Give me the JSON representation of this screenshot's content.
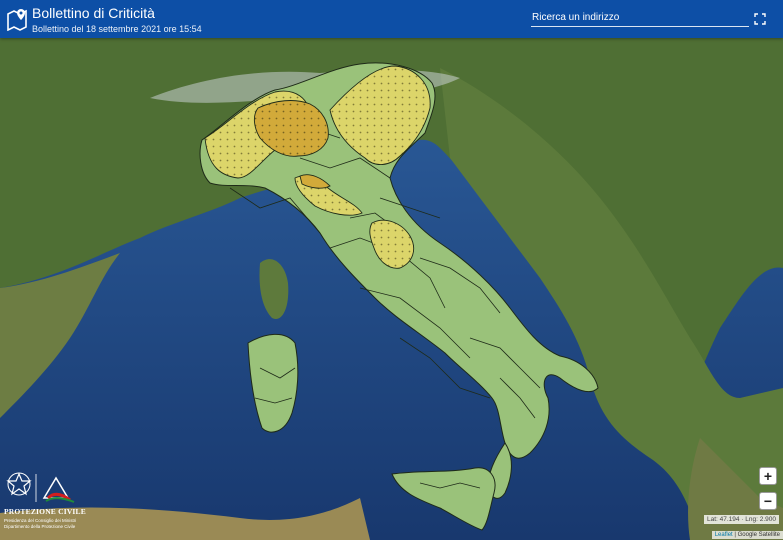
{
  "header": {
    "title": "Bollettino di Criticità",
    "subtitle": "Bollettino del 18 settembre 2021 ore 15:54",
    "search_placeholder": "Ricerca un indirizzo",
    "icon": "map-marker-icon",
    "fullscreen_icon": "fullscreen-icon"
  },
  "map": {
    "basemap": "satellite",
    "alert_levels": [
      {
        "level": "green",
        "color": "#9ac27a"
      },
      {
        "level": "yellow",
        "color": "#dcd56a"
      },
      {
        "level": "orange",
        "color": "#d2aa3a"
      }
    ],
    "zoom_in_label": "+",
    "zoom_out_label": "−",
    "coordinates": "Lat: 47.194 · Lng: 2.900",
    "attribution_link": "Leaflet",
    "attribution_sep": " | ",
    "attribution_text": "Google Satellite"
  },
  "footer_logo": {
    "name": "PROTEZIONE CIVILE",
    "line1": "Presidenza del Consiglio dei Ministri",
    "line2": "Dipartimento della Protezione Civile"
  }
}
